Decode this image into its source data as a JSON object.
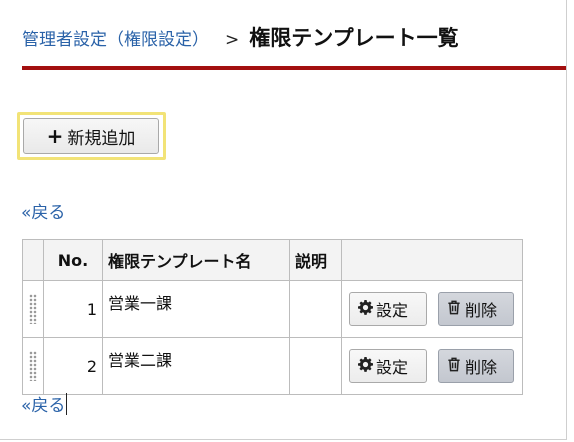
{
  "breadcrumb": {
    "parent": "管理者設定（権限設定）",
    "separator": ">",
    "current": "権限テンプレート一覧"
  },
  "toolbar": {
    "add_icon": "+",
    "add_label": "新規追加"
  },
  "back_link": "«戻る",
  "table": {
    "headers": {
      "no": "No.",
      "name": "権限テンプレート名",
      "description": "説明"
    },
    "rows": [
      {
        "no": "1",
        "name": "営業一課",
        "description": ""
      },
      {
        "no": "2",
        "name": "営業二課",
        "description": ""
      }
    ],
    "settings_label": "設定",
    "delete_label": "削除"
  },
  "icons": {
    "settings": "gear-icon",
    "delete": "trash-icon",
    "drag": "drag-handle-icon"
  },
  "colors": {
    "link": "#2a62a8",
    "title_rule": "#a30f0f",
    "highlight": "#f2e377"
  }
}
